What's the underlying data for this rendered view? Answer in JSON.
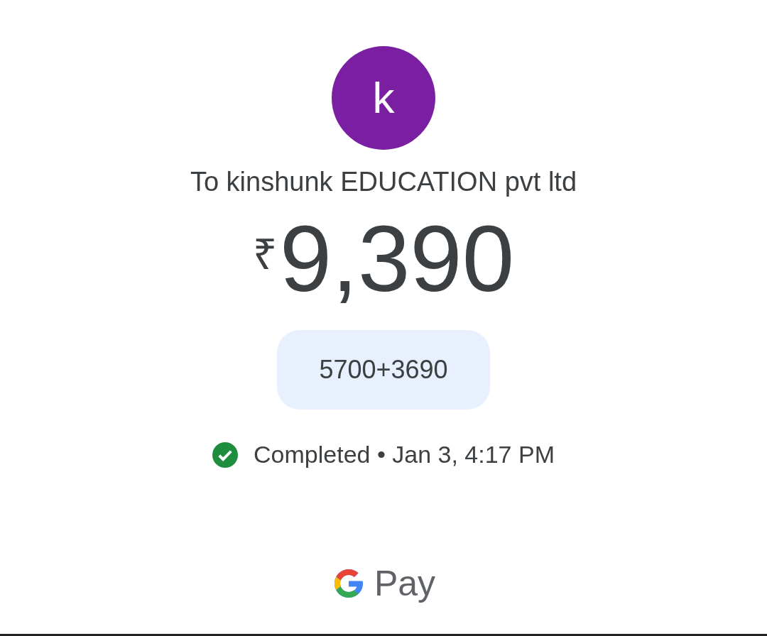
{
  "avatar": {
    "initial": "k",
    "color": "#7b1fa2"
  },
  "recipient": "To kinshunk EDUCATION pvt ltd",
  "amount": {
    "currency": "₹",
    "value": "9,390"
  },
  "note": "5700+3690",
  "status": {
    "kind": "completed",
    "text": "Completed • Jan 3, 4:17 PM"
  },
  "brand": {
    "text": "Pay"
  }
}
